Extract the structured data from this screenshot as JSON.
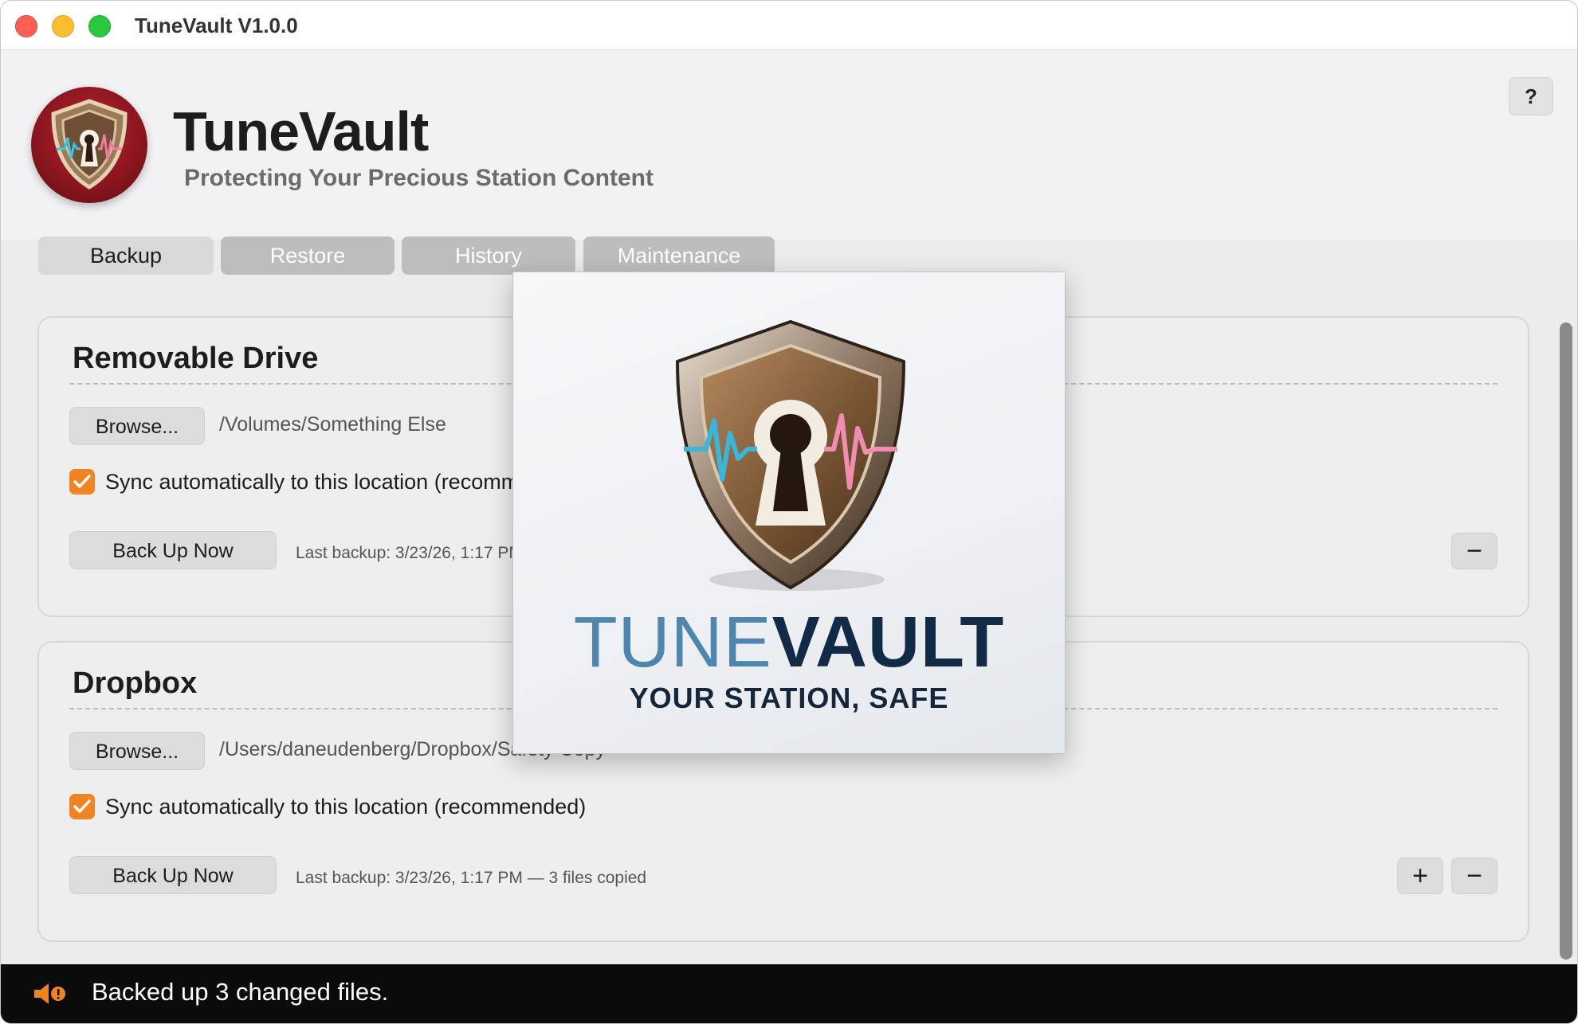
{
  "window": {
    "title": "TuneVault V1.0.0"
  },
  "header": {
    "app_name": "TuneVault",
    "tagline": "Protecting Your Precious Station Content",
    "help_label": "?"
  },
  "tabs": [
    {
      "label": "Backup",
      "active": true
    },
    {
      "label": "Restore",
      "active": false
    },
    {
      "label": "History",
      "active": false
    },
    {
      "label": "Maintenance",
      "active": false
    }
  ],
  "panels": [
    {
      "title": "Removable Drive",
      "browse_label": "Browse...",
      "path": "/Volumes/Something Else",
      "sync_checked": true,
      "sync_label": "Sync automatically to this location (recommended)",
      "backup_label": "Back Up Now",
      "last_backup": "Last backup: 3/23/26, 1:17 PM — 3 files copied",
      "remove_label": "−"
    },
    {
      "title": "Dropbox",
      "browse_label": "Browse...",
      "path": "/Users/daneudenberg/Dropbox/Safety Copy",
      "sync_checked": true,
      "sync_label": "Sync automatically to this location (recommended)",
      "backup_label": "Back Up Now",
      "last_backup": "Last backup: 3/23/26, 1:17 PM — 3 files copied",
      "add_label": "+",
      "remove_label": "−"
    }
  ],
  "status": {
    "icon": "speaker-alert-icon",
    "message": "Backed up 3 changed files."
  },
  "splash": {
    "word_light": "TUNE",
    "word_bold": "VAULT",
    "tagline": "YOUR STATION, SAFE"
  },
  "colors": {
    "accent_orange": "#f08423",
    "logo_red": "#8d1620",
    "status_bar": "#0b0b0b",
    "splash_blue_light": "#4f86ad",
    "splash_navy": "#112a45"
  }
}
